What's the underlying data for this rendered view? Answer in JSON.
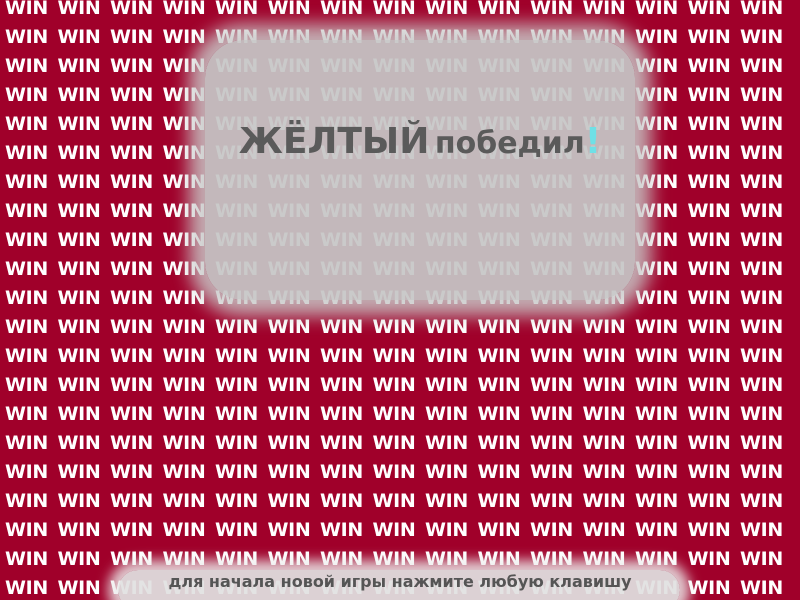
{
  "background": {
    "word": "WIN",
    "color": "#a0002a",
    "text_color": "#ffffff"
  },
  "winner": {
    "name": "ЖЁЛТЫЙ",
    "suffix": "победил",
    "punctuation": "!",
    "text_color": "#5a5a5a",
    "accent_color": "#6fe0e6"
  },
  "hint": {
    "text": "для начала новой игры нажмите любую клавишу"
  }
}
